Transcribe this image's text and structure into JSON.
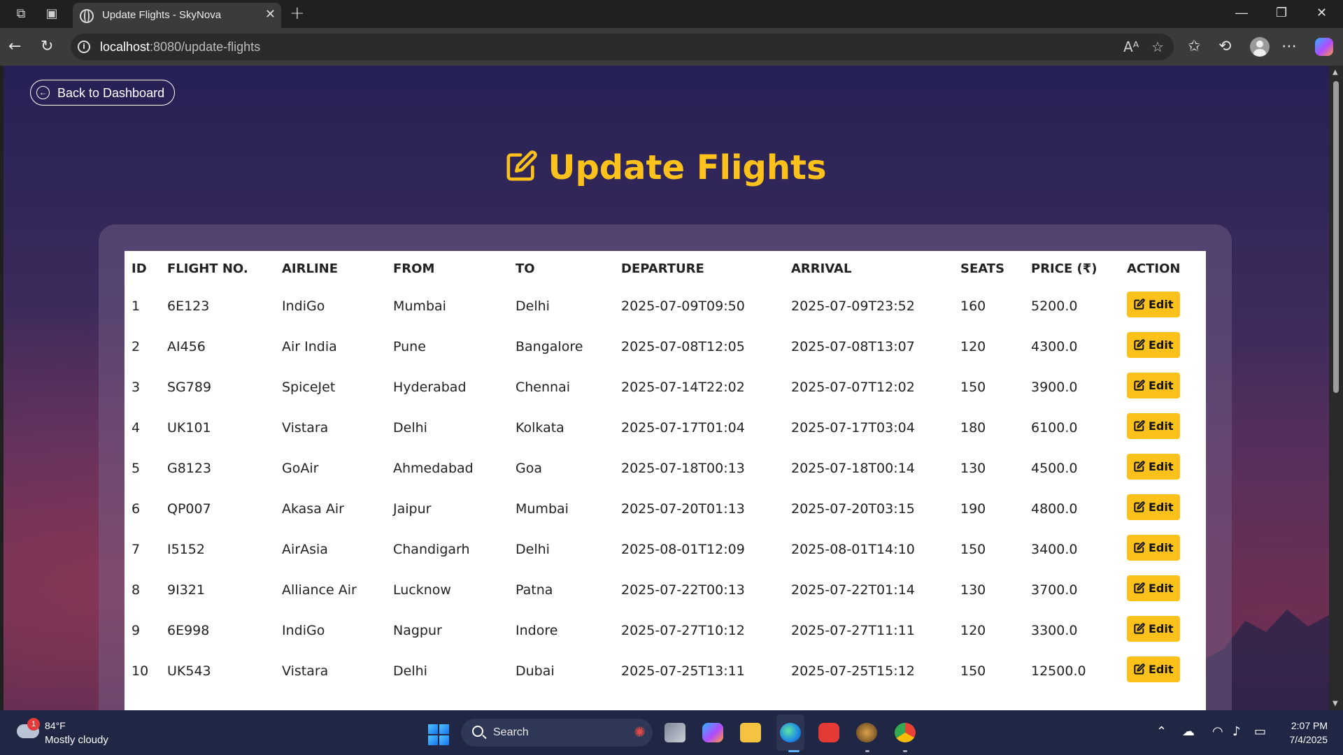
{
  "browser": {
    "tab_title": "Update Flights - SkyNova",
    "url_host": "localhost",
    "url_path": ":8080/update-flights"
  },
  "page": {
    "back_label": "Back to Dashboard",
    "title": "Update Flights",
    "accent_color": "#fcc21b",
    "columns": [
      "ID",
      "FLIGHT NO.",
      "AIRLINE",
      "FROM",
      "TO",
      "DEPARTURE",
      "ARRIVAL",
      "SEATS",
      "PRICE (₹)",
      "ACTION"
    ],
    "edit_label": "Edit",
    "flights": [
      {
        "id": "1",
        "flight_no": "6E123",
        "airline": "IndiGo",
        "from": "Mumbai",
        "to": "Delhi",
        "departure": "2025-07-09T09:50",
        "arrival": "2025-07-09T23:52",
        "seats": "160",
        "price": "5200.0"
      },
      {
        "id": "2",
        "flight_no": "AI456",
        "airline": "Air India",
        "from": "Pune",
        "to": "Bangalore",
        "departure": "2025-07-08T12:05",
        "arrival": "2025-07-08T13:07",
        "seats": "120",
        "price": "4300.0"
      },
      {
        "id": "3",
        "flight_no": "SG789",
        "airline": "SpiceJet",
        "from": "Hyderabad",
        "to": "Chennai",
        "departure": "2025-07-14T22:02",
        "arrival": "2025-07-07T12:02",
        "seats": "150",
        "price": "3900.0"
      },
      {
        "id": "4",
        "flight_no": "UK101",
        "airline": "Vistara",
        "from": "Delhi",
        "to": "Kolkata",
        "departure": "2025-07-17T01:04",
        "arrival": "2025-07-17T03:04",
        "seats": "180",
        "price": "6100.0"
      },
      {
        "id": "5",
        "flight_no": "G8123",
        "airline": "GoAir",
        "from": "Ahmedabad",
        "to": "Goa",
        "departure": "2025-07-18T00:13",
        "arrival": "2025-07-18T00:14",
        "seats": "130",
        "price": "4500.0"
      },
      {
        "id": "6",
        "flight_no": "QP007",
        "airline": "Akasa Air",
        "from": "Jaipur",
        "to": "Mumbai",
        "departure": "2025-07-20T01:13",
        "arrival": "2025-07-20T03:15",
        "seats": "190",
        "price": "4800.0"
      },
      {
        "id": "7",
        "flight_no": "I5152",
        "airline": "AirAsia",
        "from": "Chandigarh",
        "to": "Delhi",
        "departure": "2025-08-01T12:09",
        "arrival": "2025-08-01T14:10",
        "seats": "150",
        "price": "3400.0"
      },
      {
        "id": "8",
        "flight_no": "9I321",
        "airline": "Alliance Air",
        "from": "Lucknow",
        "to": "Patna",
        "departure": "2025-07-22T00:13",
        "arrival": "2025-07-22T01:14",
        "seats": "130",
        "price": "3700.0"
      },
      {
        "id": "9",
        "flight_no": "6E998",
        "airline": "IndiGo",
        "from": "Nagpur",
        "to": "Indore",
        "departure": "2025-07-27T10:12",
        "arrival": "2025-07-27T11:11",
        "seats": "120",
        "price": "3300.0"
      },
      {
        "id": "10",
        "flight_no": "UK543",
        "airline": "Vistara",
        "from": "Delhi",
        "to": "Dubai",
        "departure": "2025-07-25T13:11",
        "arrival": "2025-07-25T15:12",
        "seats": "150",
        "price": "12500.0"
      }
    ]
  },
  "taskbar": {
    "weather_temp": "84°F",
    "weather_desc": "Mostly cloudy",
    "weather_badge": "1",
    "search_label": "Search",
    "time": "2:07 PM",
    "date": "7/4/2025"
  }
}
